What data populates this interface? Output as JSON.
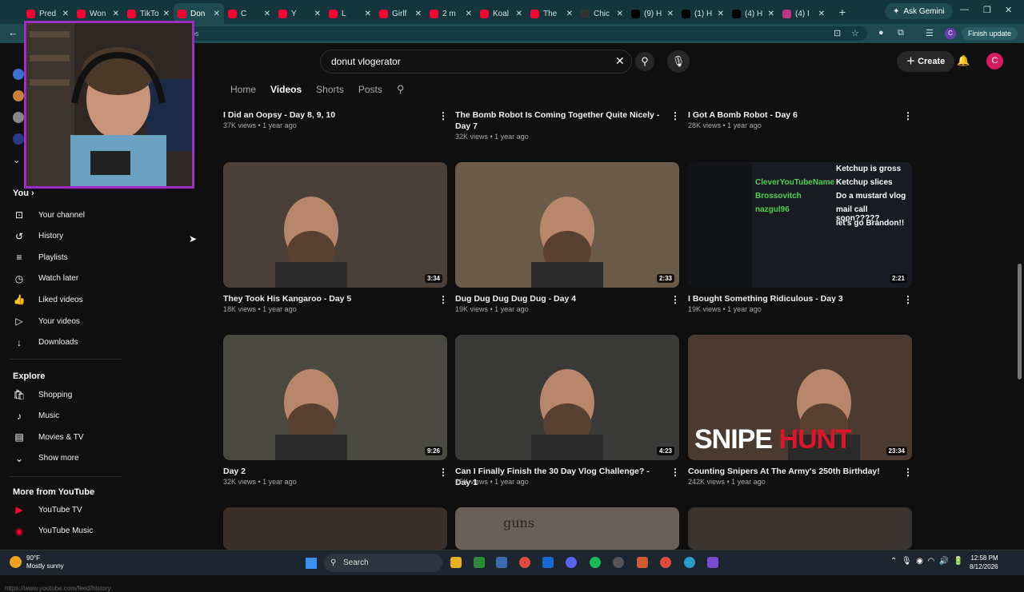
{
  "tabs": [
    {
      "label": "Pred",
      "color": "#ff0033"
    },
    {
      "label": "Won",
      "color": "#ff0033"
    },
    {
      "label": "TikTo",
      "color": "#ff0033"
    },
    {
      "label": "Don",
      "color": "#ff0033",
      "active": true
    },
    {
      "label": "C",
      "color": "#ff0033"
    },
    {
      "label": "Y",
      "color": "#ff0033"
    },
    {
      "label": "L",
      "color": "#ff0033"
    },
    {
      "label": "Girlf",
      "color": "#ff0033"
    },
    {
      "label": "2 m",
      "color": "#ff0033"
    },
    {
      "label": "Koal",
      "color": "#ff0033"
    },
    {
      "label": "The",
      "color": "#ff0033"
    },
    {
      "label": "Chic",
      "color": "#333333"
    },
    {
      "label": "(9) H",
      "color": "#000000"
    },
    {
      "label": "(1) H",
      "color": "#000000"
    },
    {
      "label": "(4) H",
      "color": "#000000"
    },
    {
      "label": "(4) I",
      "color": "#c13584"
    }
  ],
  "browser": {
    "new_tab": "+",
    "ask_gemini": "Ask Gemini",
    "url_fragment": "eos",
    "profile_letter": "C",
    "finish_update": "Finish update"
  },
  "header": {
    "search_value": "donut vlogerator",
    "create_label": "Create",
    "avatar_letter": "C"
  },
  "channel_tabs": {
    "home": "Home",
    "videos": "Videos",
    "shorts": "Shorts",
    "posts": "Posts"
  },
  "sidebar": {
    "you_label": "You",
    "you_items": [
      {
        "label": "Your channel",
        "icon": "channel-icon"
      },
      {
        "label": "History",
        "icon": "history-icon"
      },
      {
        "label": "Playlists",
        "icon": "playlists-icon"
      },
      {
        "label": "Watch later",
        "icon": "clock-icon"
      },
      {
        "label": "Liked videos",
        "icon": "thumbs-up-icon"
      },
      {
        "label": "Your videos",
        "icon": "video-icon"
      },
      {
        "label": "Downloads",
        "icon": "download-icon"
      }
    ],
    "explore_label": "Explore",
    "explore_items": [
      {
        "label": "Shopping",
        "icon": "shopping-bag-icon"
      },
      {
        "label": "Music",
        "icon": "music-note-icon"
      },
      {
        "label": "Movies & TV",
        "icon": "film-icon"
      },
      {
        "label": "Show more",
        "icon": "chevron-down-icon"
      }
    ],
    "more_label": "More from YouTube",
    "more_items": [
      {
        "label": "YouTube TV",
        "icon": "youtube-tv-icon"
      },
      {
        "label": "YouTube Music",
        "icon": "youtube-music-icon"
      }
    ],
    "url_hint": "https://www.youtube.com/feed/history"
  },
  "videos": [
    {
      "title": "I Did an Oopsy - Day 8, 9, 10",
      "meta": "37K views • 1 year ago"
    },
    {
      "title": "The Bomb Robot Is Coming Together Quite Nicely - Day 7",
      "meta": "32K views • 1 year ago"
    },
    {
      "title": "I Got A Bomb Robot - Day 6",
      "meta": "28K views • 1 year ago"
    },
    {
      "title": "They Took His Kangaroo - Day 5",
      "meta": "18K views • 1 year ago",
      "duration": "3:34"
    },
    {
      "title": "Dug Dug Dug Dug Dug - Day 4",
      "meta": "19K views • 1 year ago",
      "duration": "2:33"
    },
    {
      "title": "I Bought Something Ridiculous - Day 3",
      "meta": "19K views • 1 year ago",
      "duration": "2:21"
    },
    {
      "title": "Day 2",
      "meta": "32K views • 1 year ago",
      "duration": "9:26"
    },
    {
      "title": "Can I Finally Finish the 30 Day Vlog Challenge? - Day 1",
      "meta": "25K views • 1 year ago",
      "duration": "4:23"
    },
    {
      "title": "Counting Snipers At The Army's 250th Birthday!",
      "meta": "242K views • 1 year ago",
      "duration": "23:34"
    }
  ],
  "thumb_text": {
    "snipe": "SNIPE",
    "hunt": "HUNT",
    "overlay_lines": [
      "Ketchup is gross",
      "Ketchup slices",
      "Do a mustard vlog",
      "mail call soon?????",
      "let's go Brandon!!"
    ],
    "overlay_names": [
      "CleverYouTubeName",
      "Brossovitch",
      "nazgul96"
    ],
    "guns": "guns"
  },
  "taskbar": {
    "temp": "90°F",
    "weather": "Mostly sunny",
    "search": "Search",
    "time": "12:58 PM",
    "date": "8/12/2026"
  }
}
